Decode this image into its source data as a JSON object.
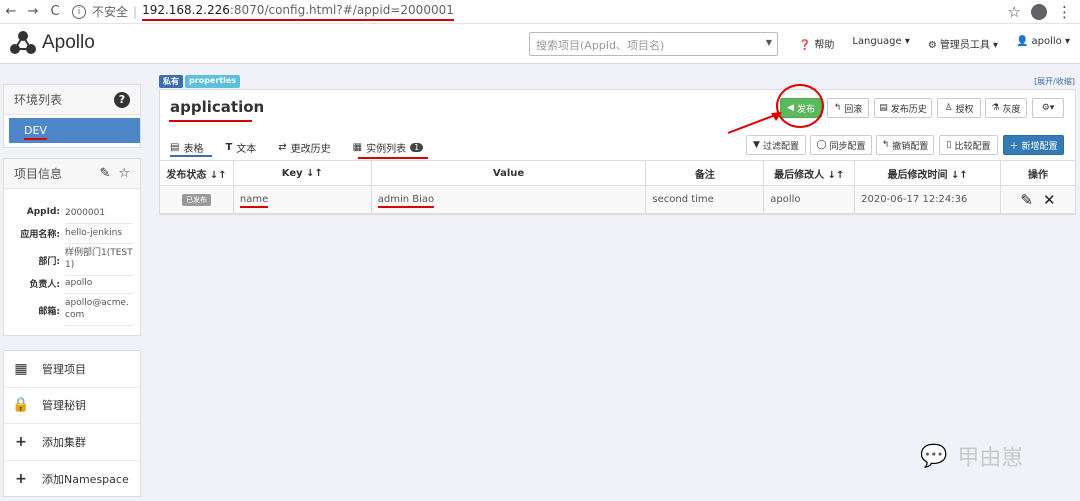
{
  "browser": {
    "insecure_label": "不安全",
    "url_host": "192.168.2.226",
    "url_rest": ":8070/config.html?#/appid=2000001"
  },
  "navbar": {
    "logo_text": "Apollo",
    "search_placeholder": "搜索项目(AppId、项目名)",
    "help": "帮助",
    "language": "Language",
    "admin_tools": "管理员工具",
    "user": "apollo"
  },
  "env": {
    "title": "环境列表",
    "selected": "DEV"
  },
  "project_info": {
    "title": "项目信息",
    "rows": [
      {
        "key": "AppId:",
        "value": "2000001"
      },
      {
        "key": "应用名称:",
        "value": "hello-jenkins"
      },
      {
        "key": "部门:",
        "value": "样例部门1(TEST1)"
      },
      {
        "key": "负责人:",
        "value": "apollo"
      },
      {
        "key": "邮箱:",
        "value": "apollo@acme.com"
      }
    ]
  },
  "menu": {
    "items": [
      "管理项目",
      "管理秘钥",
      "添加集群",
      "添加Namespace"
    ]
  },
  "namespace": {
    "tag_private": "私有",
    "tag_format": "properties",
    "expand_toggle": "[展开/收缩]",
    "name": "application",
    "buttons": {
      "publish": "发布",
      "rollback": "回滚",
      "history": "发布历史",
      "authorize": "授权",
      "gray": "灰度",
      "filter": "过滤配置",
      "sync": "同步配置",
      "revoke": "撤销配置",
      "compare": "比较配置",
      "add": "新增配置"
    },
    "tabs": {
      "table": "表格",
      "text": "文本",
      "history": "更改历史",
      "instances": "实例列表",
      "instances_count": "1"
    }
  },
  "table": {
    "headers": {
      "status": "发布状态",
      "key": "Key",
      "value": "Value",
      "comment": "备注",
      "modifier": "最后修改人",
      "modified_time": "最后修改时间",
      "ops": "操作"
    },
    "row": {
      "status": "已发布",
      "key": "name",
      "value": "admin Biao",
      "comment": "second time",
      "modifier": "apollo",
      "modified_time": "2020-06-17 12:24:36"
    }
  },
  "watermark": "甲由崽"
}
